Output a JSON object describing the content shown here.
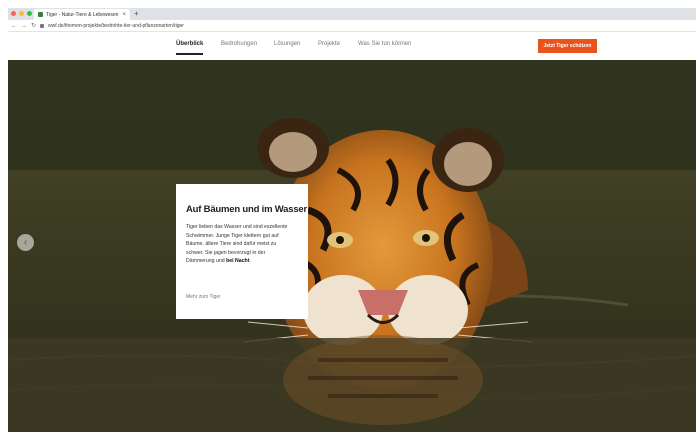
{
  "browser": {
    "tab_title": "Tiger - Natur-Tiere & Lebewesen",
    "tab_close": "×",
    "new_tab": "+",
    "back": "←",
    "forward": "→",
    "reload": "↻",
    "url": "wwf.de/themen-projekte/bedrohte-tier-und-pflanzenarten/tiger",
    "dot_colors": [
      "#ff5f57",
      "#febc2e",
      "#28c840"
    ]
  },
  "nav": {
    "items": [
      {
        "label": "Überblick",
        "active": true
      },
      {
        "label": "Bedrohungen",
        "active": false
      },
      {
        "label": "Lösungen",
        "active": false
      },
      {
        "label": "Projekte",
        "active": false
      },
      {
        "label": "Was Sie tun können",
        "active": false
      }
    ],
    "cta_label": "Jetzt Tiger schützen",
    "cta_color": "#e8541c"
  },
  "hero": {
    "prev_arrow": "‹",
    "card": {
      "title": "Auf Bäumen und im Wasser",
      "body_lines": [
        "Tiger lieben das Wasser und sind exzellente",
        "Schwimmer. Junge Tiger klettern gut auf",
        "Bäume, ältere Tiere sind dafür meist zu",
        "schwer. Sie jagen bevorzugt in der",
        "Dämmerung und"
      ],
      "body_strong": "bei Nacht",
      "link": "Mehr zum Tiger"
    }
  }
}
